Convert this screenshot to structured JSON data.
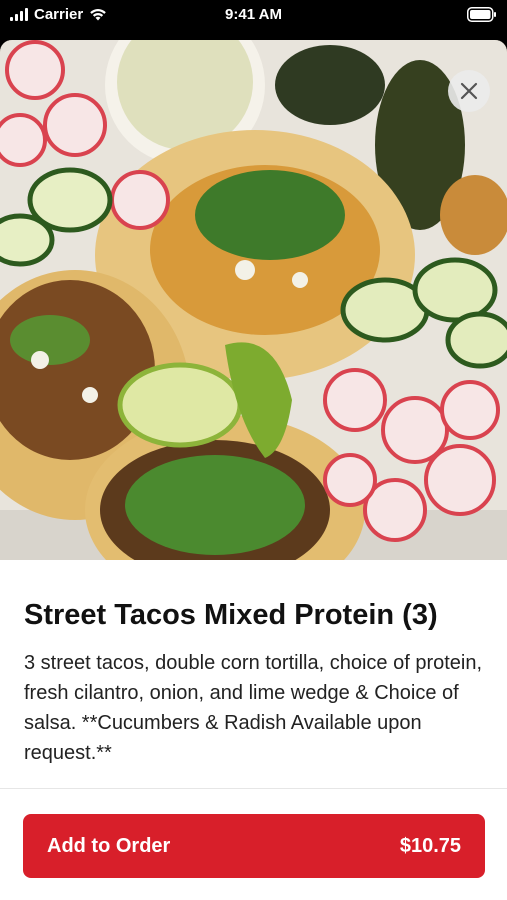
{
  "status_bar": {
    "carrier": "Carrier",
    "time": "9:41 AM"
  },
  "hero": {
    "image_alt": "Street tacos with cilantro, onion, lime, cucumbers and radish"
  },
  "item": {
    "title": "Street Tacos Mixed Protein (3)",
    "description": "3 street tacos, double corn tortilla, choice of protein, fresh cilantro, onion, and lime wedge & Choice of salsa.  **Cucumbers & Radish Available upon request.**"
  },
  "footer": {
    "add_label": "Add to Order",
    "price": "$10.75"
  },
  "colors": {
    "accent": "#d81f2a"
  },
  "icons": {
    "close": "close-icon",
    "signal": "signal-icon",
    "wifi": "wifi-icon",
    "battery": "battery-icon"
  }
}
